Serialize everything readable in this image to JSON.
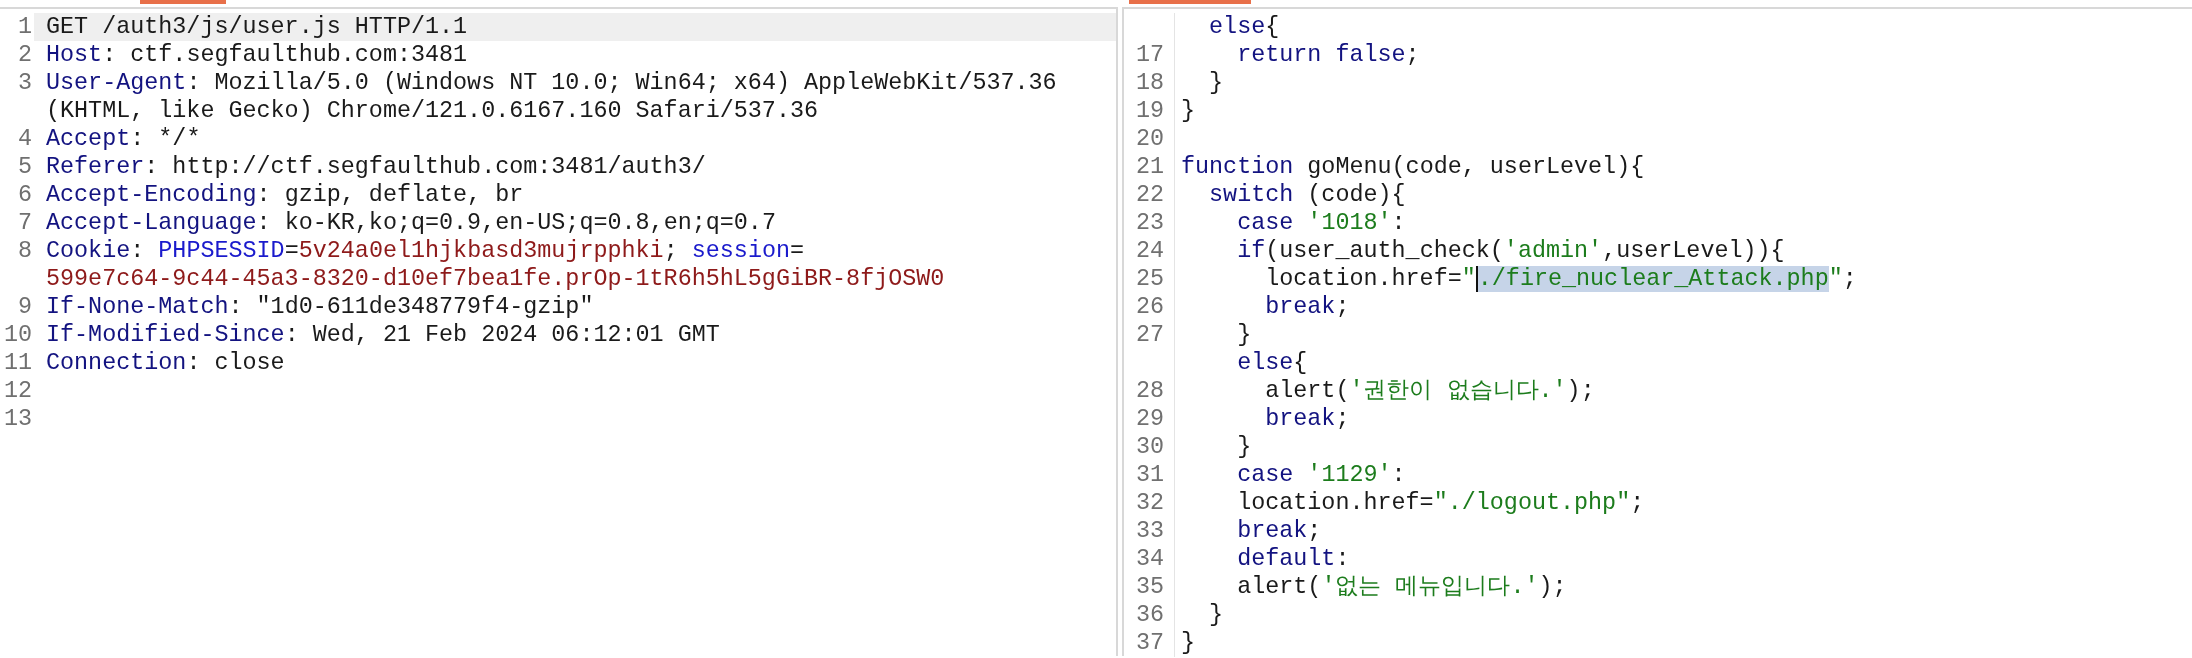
{
  "request_pane": {
    "lines": [
      {
        "number": "1",
        "current": true,
        "segments": [
          {
            "kind": "text",
            "text": "GET /auth3/js/user.js HTTP/1.1"
          }
        ]
      },
      {
        "number": "2",
        "current": false,
        "segments": [
          {
            "kind": "name",
            "text": "Host"
          },
          {
            "kind": "text",
            "text": ": ctf.segfaulthub.com:3481"
          }
        ]
      },
      {
        "number": "3",
        "current": false,
        "segments": [
          {
            "kind": "name",
            "text": "User-Agent"
          },
          {
            "kind": "text",
            "text": ": Mozilla/5.0 (Windows NT 10.0; Win64; x64) AppleWebKit/537.36"
          }
        ]
      },
      {
        "current": false,
        "segments": [
          {
            "kind": "text",
            "text": "(KHTML, like Gecko) Chrome/121.0.6167.160 Safari/537.36"
          }
        ]
      },
      {
        "number": "4",
        "current": false,
        "segments": [
          {
            "kind": "name",
            "text": "Accept"
          },
          {
            "kind": "text",
            "text": ": */*"
          }
        ]
      },
      {
        "number": "5",
        "current": false,
        "segments": [
          {
            "kind": "name",
            "text": "Referer"
          },
          {
            "kind": "text",
            "text": ": http://ctf.segfaulthub.com:3481/auth3/"
          }
        ]
      },
      {
        "number": "6",
        "current": false,
        "segments": [
          {
            "kind": "name",
            "text": "Accept-Encoding"
          },
          {
            "kind": "text",
            "text": ": gzip, deflate, br"
          }
        ]
      },
      {
        "number": "7",
        "current": false,
        "segments": [
          {
            "kind": "name",
            "text": "Accept-Language"
          },
          {
            "kind": "text",
            "text": ": ko-KR,ko;q=0.9,en-US;q=0.8,en;q=0.7"
          }
        ]
      },
      {
        "number": "8",
        "current": false,
        "segments": [
          {
            "kind": "name",
            "text": "Cookie"
          },
          {
            "kind": "text",
            "text": ": "
          },
          {
            "kind": "param-name",
            "text": "PHPSESSID"
          },
          {
            "kind": "text",
            "text": "="
          },
          {
            "kind": "param-value",
            "text": "5v24a0el1hjkbasd3mujrpphki"
          },
          {
            "kind": "text",
            "text": "; "
          },
          {
            "kind": "param-name",
            "text": "session"
          },
          {
            "kind": "text",
            "text": "="
          }
        ]
      },
      {
        "current": false,
        "segments": [
          {
            "kind": "param-value",
            "text": "599e7c64-9c44-45a3-8320-d10ef7bea1fe.prOp-1tR6h5hL5gGiBR-8fjOSW0"
          }
        ]
      },
      {
        "number": "9",
        "current": false,
        "segments": [
          {
            "kind": "name",
            "text": "If-None-Match"
          },
          {
            "kind": "text",
            "text": ": \"1d0-611de348779f4-gzip\""
          }
        ]
      },
      {
        "number": "10",
        "current": false,
        "segments": [
          {
            "kind": "name",
            "text": "If-Modified-Since"
          },
          {
            "kind": "text",
            "text": ": Wed, 21 Feb 2024 06:12:01 GMT"
          }
        ]
      },
      {
        "number": "11",
        "current": false,
        "segments": [
          {
            "kind": "name",
            "text": "Connection"
          },
          {
            "kind": "text",
            "text": ": close"
          }
        ]
      },
      {
        "number": "12"
      },
      {
        "number": "13"
      }
    ]
  },
  "response_pane": {
    "lines": [
      {
        "segments": [
          {
            "kind": "name",
            "text": "  else"
          },
          {
            "kind": "text",
            "text": "{"
          }
        ]
      },
      {
        "number": "17",
        "segments": [
          {
            "kind": "name",
            "text": "    return false"
          },
          {
            "kind": "text",
            "text": ";"
          }
        ]
      },
      {
        "number": "18",
        "segments": [
          {
            "kind": "text",
            "text": "  }"
          }
        ]
      },
      {
        "number": "19",
        "segments": [
          {
            "kind": "text",
            "text": "}"
          }
        ]
      },
      {
        "number": "20"
      },
      {
        "number": "21",
        "segments": [
          {
            "kind": "name",
            "text": "function"
          },
          {
            "kind": "text",
            "text": " goMenu(code, userLevel){"
          }
        ]
      },
      {
        "number": "22",
        "segments": [
          {
            "kind": "name",
            "text": "  switch"
          },
          {
            "kind": "text",
            "text": " (code){"
          }
        ]
      },
      {
        "number": "23",
        "segments": [
          {
            "kind": "name",
            "text": "    case "
          },
          {
            "kind": "string",
            "text": "'1018'"
          },
          {
            "kind": "text",
            "text": ":"
          }
        ]
      },
      {
        "number": "24",
        "segments": [
          {
            "kind": "name",
            "text": "    if"
          },
          {
            "kind": "text",
            "text": "(user_auth_check("
          },
          {
            "kind": "string",
            "text": "'admin'"
          },
          {
            "kind": "text",
            "text": ",userLevel)){"
          }
        ]
      },
      {
        "number": "25",
        "segments": [
          {
            "kind": "text",
            "text": "      location.href="
          },
          {
            "kind": "string",
            "text": "\""
          },
          {
            "kind": "string",
            "text": "./fire_nuclear_Attack.php",
            "highlighted": true,
            "caret": true
          },
          {
            "kind": "string",
            "text": "\""
          },
          {
            "kind": "text",
            "text": ";"
          }
        ]
      },
      {
        "number": "26",
        "segments": [
          {
            "kind": "name",
            "text": "      break"
          },
          {
            "kind": "text",
            "text": ";"
          }
        ]
      },
      {
        "number": "27",
        "segments": [
          {
            "kind": "text",
            "text": "    }"
          }
        ]
      },
      {
        "segments": [
          {
            "kind": "name",
            "text": "    else"
          },
          {
            "kind": "text",
            "text": "{"
          }
        ]
      },
      {
        "number": "28",
        "segments": [
          {
            "kind": "text",
            "text": "      alert("
          },
          {
            "kind": "string",
            "text": "'권한이 없습니다.'"
          },
          {
            "kind": "text",
            "text": ");"
          }
        ]
      },
      {
        "number": "29",
        "segments": [
          {
            "kind": "name",
            "text": "      break"
          },
          {
            "kind": "text",
            "text": ";"
          }
        ]
      },
      {
        "number": "30",
        "segments": [
          {
            "kind": "text",
            "text": "    }"
          }
        ]
      },
      {
        "number": "31",
        "segments": [
          {
            "kind": "name",
            "text": "    case "
          },
          {
            "kind": "string",
            "text": "'1129'"
          },
          {
            "kind": "text",
            "text": ":"
          }
        ]
      },
      {
        "number": "32",
        "segments": [
          {
            "kind": "text",
            "text": "    location.href="
          },
          {
            "kind": "string",
            "text": "\"./logout.php\""
          },
          {
            "kind": "text",
            "text": ";"
          }
        ]
      },
      {
        "number": "33",
        "segments": [
          {
            "kind": "name",
            "text": "    break"
          },
          {
            "kind": "text",
            "text": ";"
          }
        ]
      },
      {
        "number": "34",
        "segments": [
          {
            "kind": "name",
            "text": "    default"
          },
          {
            "kind": "text",
            "text": ":"
          }
        ]
      },
      {
        "number": "35",
        "segments": [
          {
            "kind": "text",
            "text": "    alert("
          },
          {
            "kind": "string",
            "text": "'없는 메뉴입니다.'"
          },
          {
            "kind": "text",
            "text": ");"
          }
        ]
      },
      {
        "number": "36",
        "segments": [
          {
            "kind": "text",
            "text": "  }"
          }
        ]
      },
      {
        "number": "37",
        "segments": [
          {
            "kind": "text",
            "text": "}"
          }
        ]
      }
    ]
  }
}
